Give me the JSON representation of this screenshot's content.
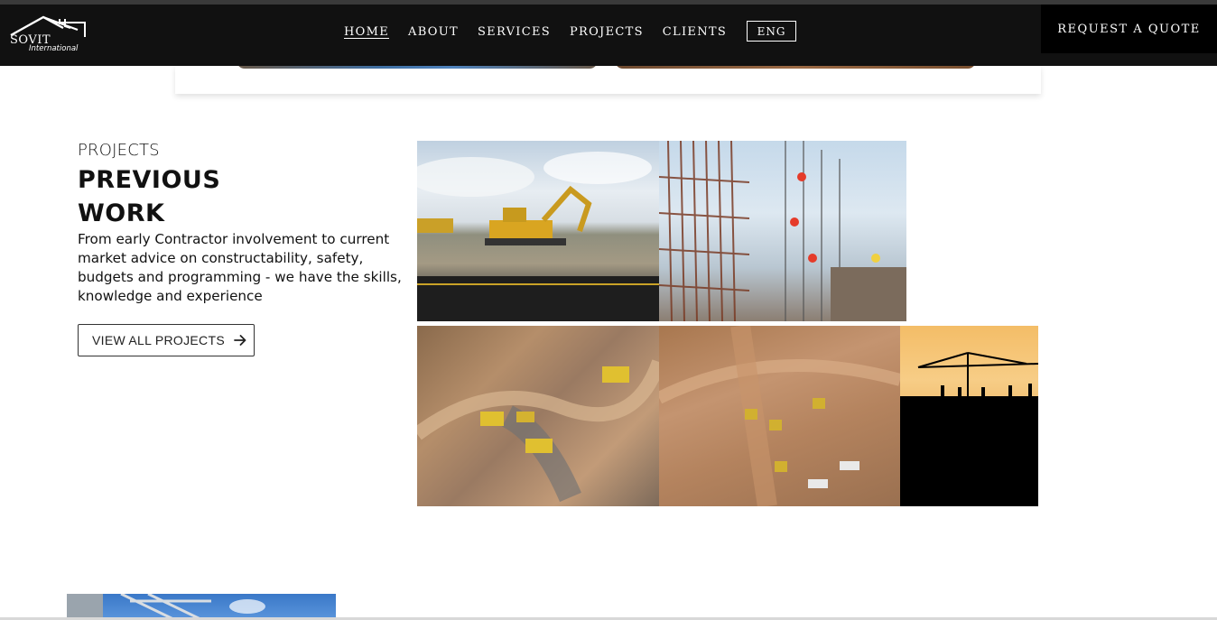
{
  "brand": {
    "logo_name": "SOVIT",
    "logo_sub": "International",
    "logo_icon": "house-roof-icon"
  },
  "nav": {
    "items": [
      {
        "label": "HOME",
        "active": true
      },
      {
        "label": "ABOUT",
        "active": false
      },
      {
        "label": "SERVICES",
        "active": false
      },
      {
        "label": "PROJECTS",
        "active": false
      },
      {
        "label": "CLIENTS",
        "active": false
      }
    ],
    "language": "ENG",
    "cta": "REQUEST A QUOTE"
  },
  "projects_section": {
    "eyebrow": "PROJECTS",
    "heading_line1": "PREVIOUS",
    "heading_line2": "WORK",
    "description": "From early Contractor involvement to current market advice on constructability, safety, budgets and programming - we have the skills, knowledge and experience",
    "button_label": "VIEW ALL PROJECTS",
    "button_icon": "arrow-right-icon"
  },
  "gallery": [
    {
      "name": "excavator-on-road-photo"
    },
    {
      "name": "workers-on-rebar-photo"
    },
    {
      "name": "aerial-earthworks-photo"
    },
    {
      "name": "aerial-mining-site-photo"
    },
    {
      "name": "crane-silhouette-sunset-photo"
    }
  ],
  "colors": {
    "navbar_bg": "#111111",
    "nav_text": "#ffffff",
    "page_bg": "#ffffff",
    "text_dark": "#111111"
  }
}
